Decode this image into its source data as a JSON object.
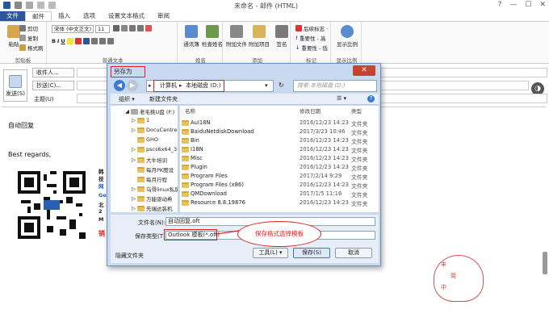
{
  "window": {
    "title": "未命名 - 邮件 (HTML)",
    "help": "?",
    "minimize": "—",
    "maximize": "☐",
    "close": "✕"
  },
  "ribbon_tabs": [
    "文件",
    "邮件",
    "插入",
    "选项",
    "设置文本格式",
    "审阅"
  ],
  "ribbon": {
    "clipboard": {
      "paste": "粘贴",
      "cut": "剪切",
      "copy": "复制",
      "format_painter": "格式刷",
      "label": "剪贴板"
    },
    "basic_text": {
      "font": "宋体 (中文正文)",
      "size": "11",
      "label": "普通文本"
    },
    "names": {
      "address_book": "通讯簿",
      "check_names": "检查姓名",
      "label": "姓名"
    },
    "include": {
      "attach_file": "附加文件",
      "attach_item": "附加项目",
      "signature": "签名",
      "label": "添加"
    },
    "tags": {
      "follow_up": "后续标志 ·",
      "high": "重要性 - 高",
      "low": "重要性 - 低",
      "label": "标记"
    },
    "zoom": {
      "zoom": "显示比例",
      "label": "显示比例"
    }
  },
  "compose": {
    "send": "发送(S)",
    "to": "收件人...",
    "cc": "抄送(C)...",
    "subject": "主题(U)",
    "greeting": "自动回复",
    "closing": "Best regards,",
    "signature_lines": [
      "韩",
      "技",
      "网",
      "Ge",
      "北",
      "2",
      "M",
      "销"
    ],
    "sticker_chars": [
      "丰",
      "简",
      "中"
    ]
  },
  "dialog": {
    "title": "另存为",
    "close": "✕",
    "path": [
      "计算机",
      "本地磁盘 (D:)"
    ],
    "search_placeholder": "搜索 本地磁盘 (D:)",
    "toolbar": {
      "organize": "组织 ▾",
      "new_folder": "新建文件夹",
      "view": "☰ ▾",
      "help": "?"
    },
    "tree": [
      "老毛桃U盘 (F:)",
      "1",
      "DocuCentre",
      "GHO",
      "pscs6x64_3",
      "大牛培训",
      "每月PK图设",
      "每月行程",
      "乌哥linux私房",
      "万能驱动希",
      "先瑞达装机"
    ],
    "columns": {
      "name": "名称",
      "date": "修改日期",
      "type": "类型"
    },
    "files": [
      {
        "name": "Aul18N",
        "date": "2016/12/23 14:23",
        "type": "文件夹"
      },
      {
        "name": "BaiduNetdiskDownload",
        "date": "2017/3/23 10:46",
        "type": "文件夹"
      },
      {
        "name": "Bin",
        "date": "2016/12/23 14:23",
        "type": "文件夹"
      },
      {
        "name": "I18N",
        "date": "2016/12/23 14:23",
        "type": "文件夹"
      },
      {
        "name": "Misc",
        "date": "2016/12/23 14:23",
        "type": "文件夹"
      },
      {
        "name": "Plugin",
        "date": "2016/12/23 14:23",
        "type": "文件夹"
      },
      {
        "name": "Program Files",
        "date": "2017/2/14 9:29",
        "type": "文件夹"
      },
      {
        "name": "Program Files (x86)",
        "date": "2016/12/23 14:23",
        "type": "文件夹"
      },
      {
        "name": "QMDownload",
        "date": "2017/1/5 11:16",
        "type": "文件夹"
      },
      {
        "name": "Resource 8.8.19876",
        "date": "2016/12/23 14:23",
        "type": "文件夹"
      }
    ],
    "filename_label": "文件名(N):",
    "filename_value": "自动回复.oft",
    "filetype_label": "保存类型(T):",
    "filetype_value": "Outlook 模板(*.oft)",
    "hide_folders": "隐藏文件夹",
    "tools": "工具(L) ▾",
    "save": "保存(S)",
    "cancel": "取消"
  },
  "annotation": "保存格式选择模板"
}
